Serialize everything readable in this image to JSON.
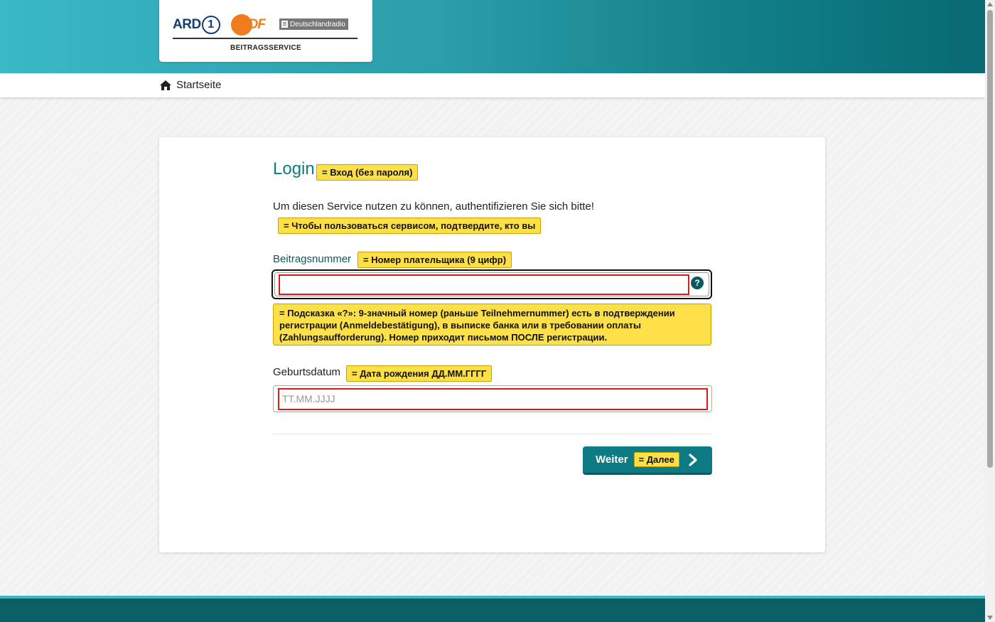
{
  "header": {
    "logo_ard": "ARD",
    "logo_ard_number": "1",
    "logo_zdf": "ZDF",
    "logo_deutschlandradio": "Deutschlandradio",
    "logo_subtitle": "BEITRAGSSERVICE"
  },
  "nav": {
    "home_label": "Startseite"
  },
  "login": {
    "title": "Login",
    "title_annotation": "= Вход (без пароля)",
    "intro": "Um diesen Service nutzen zu können, authentifizieren Sie sich bitte!",
    "intro_annotation": "= Чтобы пользоваться сервисом, подтвердите, кто вы",
    "field1_label": "Beitragsnummer",
    "field1_annotation": "= Номер плательщика (9 цифр)",
    "field1_value": "",
    "help_icon_text": "?",
    "field1_hint": "= Подсказка «?»: 9-значный номер (раньше Teilnehmernummer) есть в подтверждении регистрации (Anmeldebestätigung), в выписке банка или в требовании оплаты (Zahlungsaufforderung). Номер приходит письмом ПОСЛЕ регистрации.",
    "field2_label": "Geburtsdatum",
    "field2_annotation": "= Дата рождения ДД.ММ.ГГГГ",
    "field2_placeholder": "TT.MM.JJJJ",
    "submit_label": "Weiter",
    "submit_annotation": "= Далее"
  },
  "colors": {
    "accent": "#0e7a83",
    "highlight": "#fde047",
    "error_outline": "#d81c1c"
  },
  "icons": {
    "home": "home-icon",
    "help": "help-icon",
    "next": "chevron-right-icon"
  }
}
